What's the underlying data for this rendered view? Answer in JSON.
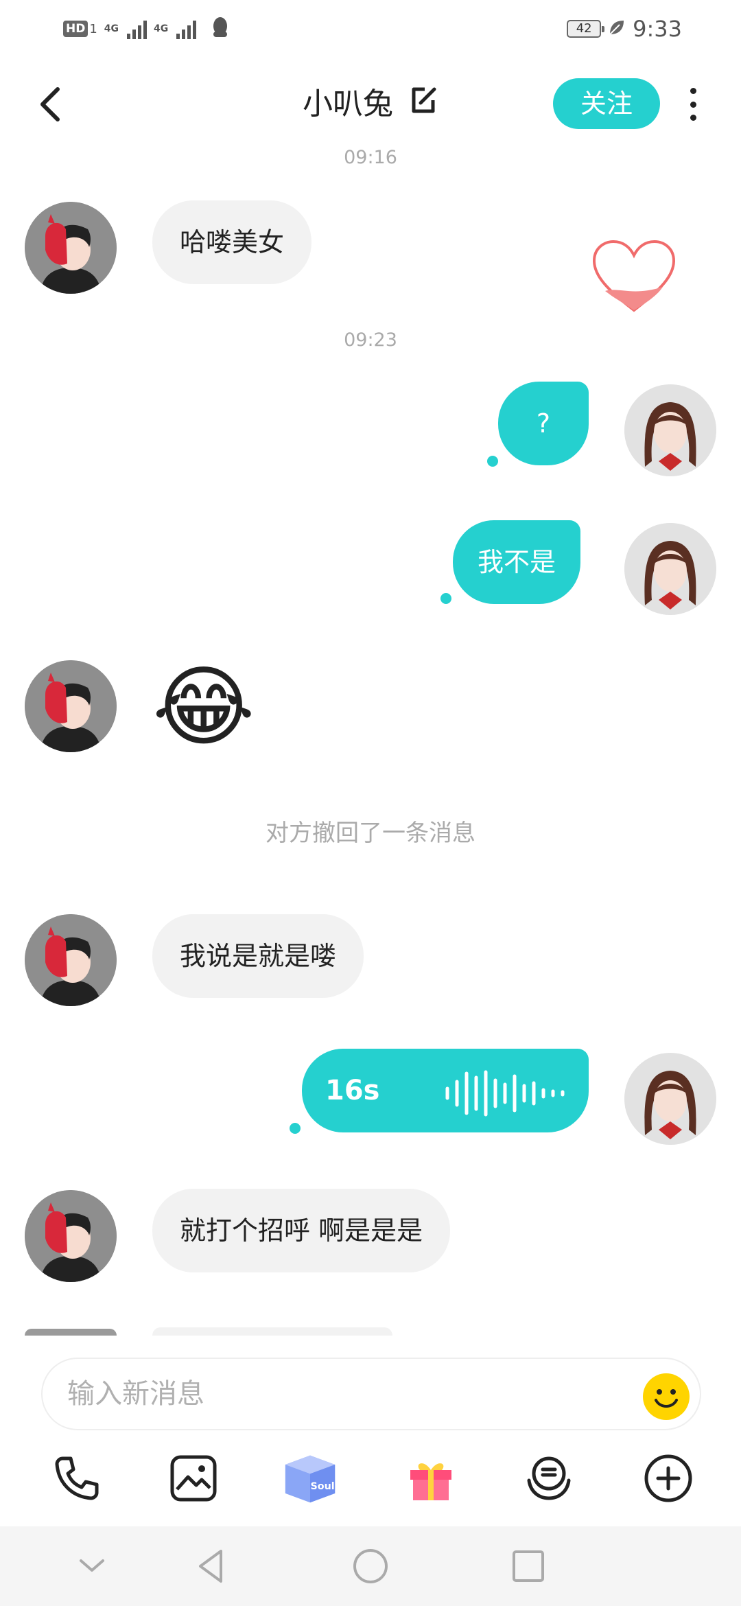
{
  "status_bar": {
    "hd": "HD",
    "sim1": "1",
    "net1": "4G",
    "net2": "4G",
    "battery": "42",
    "time": "9:33"
  },
  "header": {
    "title": "小叭兔",
    "follow_label": "关注"
  },
  "messages": {
    "time1": "09:16",
    "m1": "哈喽美女",
    "time2": "09:23",
    "m2": "?",
    "m3": "我不是",
    "m4_emoji": "😂",
    "recall": "对方撤回了一条消息",
    "m5": "我说是就是喽",
    "voice_duration": "16s",
    "m6": "就打个招呼 啊是是是"
  },
  "input": {
    "placeholder": "输入新消息"
  },
  "toolbar": {
    "soul_label": "Soul"
  },
  "colors": {
    "accent": "#25d0cf",
    "bubble_gray": "#f2f2f2",
    "heart": "#f38b8b"
  }
}
